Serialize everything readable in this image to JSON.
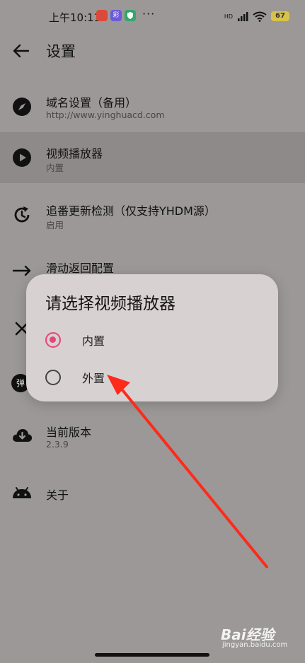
{
  "status_bar": {
    "time": "上午10:11",
    "apps": [
      {
        "icon": "app-notification-icon",
        "text": "",
        "color": "#d94a3a"
      },
      {
        "icon": "app-notification-icon",
        "text": "彩",
        "color": "#6c5bd6"
      },
      {
        "icon": "shield-icon",
        "text": "",
        "color": "#31a86a"
      }
    ],
    "more": "···",
    "network_label": "HD",
    "battery": "67"
  },
  "app_bar": {
    "title": "设置",
    "back_icon": "arrow-left-icon"
  },
  "settings": [
    {
      "title": "域名设置（备用）",
      "subtitle": "http://www.yinghuacd.com",
      "icon": "compass-icon"
    },
    {
      "title": "视频播放器",
      "subtitle": "内置",
      "icon": "play-circle-icon"
    },
    {
      "title": "追番更新检测（仅支持YHDM源）",
      "subtitle": "启用",
      "icon": "refresh-clock-icon"
    },
    {
      "title": "滑动返回配置",
      "subtitle": "",
      "icon": "arrow-right-icon"
    },
    {
      "title": "",
      "subtitle": "",
      "icon": "close-icon"
    },
    {
      "title": "",
      "subtitle": "",
      "icon": "danmaku-icon",
      "badge": "弹"
    },
    {
      "title": "当前版本",
      "subtitle": "2.3.9",
      "icon": "cloud-download-icon"
    },
    {
      "title": "关于",
      "subtitle": "",
      "icon": "android-icon"
    }
  ],
  "dialog": {
    "title": "请选择视频播放器",
    "options": [
      {
        "label": "内置",
        "selected": true
      },
      {
        "label": "外置",
        "selected": false
      }
    ]
  },
  "watermark": {
    "brand": "Bai经验",
    "url": "jingyan.baidu.com"
  },
  "colors": {
    "accent": "#e5457a",
    "scrim": "#9c9898",
    "dialog_bg": "#d8d1d1",
    "annotation_arrow": "#ff2a1a"
  }
}
